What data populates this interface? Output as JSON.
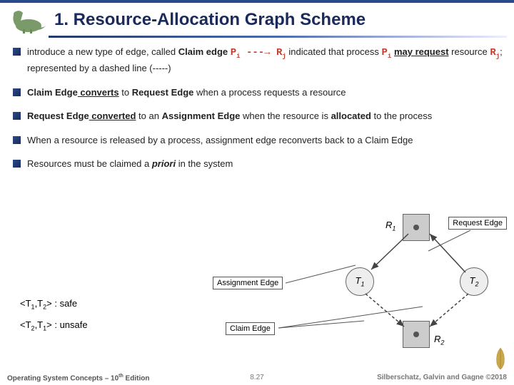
{
  "title": "1. Resource-Allocation Graph Scheme",
  "bullets": {
    "b1_a": "introduce a new type of edge, called ",
    "b1_b": "Claim edge",
    "b1_c": " ---→ ",
    "b1_d": " indicated that process ",
    "b1_e": "may request",
    "b1_f": " resource ",
    "b1_g": "; represented by a dashed line (-----)",
    "pi": "P",
    "pi_sub": "i",
    "rj": "R",
    "rj_sub": "j",
    "b2_a": "Claim Edge",
    "b2_b": " converts",
    "b2_c": " to ",
    "b2_d": "Request Edge",
    "b2_e": " when a process requests a resource",
    "b3_a": "Request Edge",
    "b3_b": " converted",
    "b3_c": " to an ",
    "b3_d": "Assignment Edge",
    "b3_e": " when the resource is ",
    "b3_f": "allocated",
    "b3_g": " to the process",
    "b4": "When a resource is released by a process, assignment edge reconverts back to a Claim Edge",
    "b5_a": "Resources must be claimed a ",
    "b5_b": "priori",
    "b5_c": " in the system"
  },
  "labels": {
    "request_edge": "Request Edge",
    "assignment_edge": "Assignment Edge",
    "claim_edge": "Claim Edge"
  },
  "seq": {
    "s1_a": "<T",
    "s1_b": "1",
    "s1_c": ",T",
    "s1_d": "2",
    "s1_e": "> : safe",
    "s2_a": "<T",
    "s2_b": "2",
    "s2_c": ",T",
    "s2_d": "1",
    "s2_e": "> : unsafe"
  },
  "diagram": {
    "r1": "R",
    "r1_sub": "1",
    "r2": "R",
    "r2_sub": "2",
    "t1": "T",
    "t1_sub": "1",
    "t2": "T",
    "t2_sub": "2"
  },
  "footer": {
    "left_a": "Operating System Concepts – 10",
    "left_sup": "th",
    "left_b": " Edition",
    "mid": "8.27",
    "right": "Silberschatz, Galvin and Gagne ©2018"
  }
}
